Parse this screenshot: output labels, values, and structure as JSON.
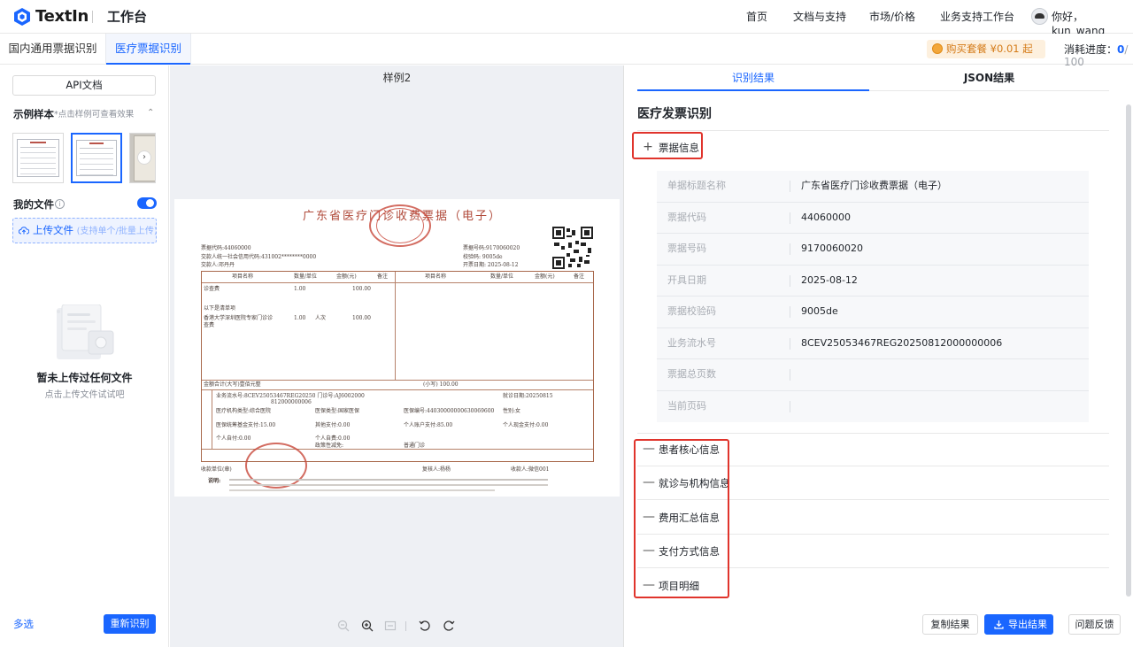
{
  "header": {
    "brand": "TextIn",
    "workspace": "工作台",
    "nav": [
      "首页",
      "文档与支持",
      "市场/价格",
      "业务支持工作台"
    ],
    "greeting": "你好，kun_wang"
  },
  "tabs": {
    "items": [
      "国内通用票据识别",
      "医疗票据识别"
    ],
    "active_index": 1,
    "buy_label": "购买套餐 ¥0.01 起",
    "usage_label": "消耗进度：",
    "usage_current": "0",
    "usage_total": "/ 100"
  },
  "left": {
    "api_doc_label": "API文档",
    "samples_title": "示例样本",
    "samples_hint": "*点击样例可查看效果",
    "my_files": "我的文件",
    "upload_label": "上传文件",
    "upload_sub": "(支持单个/批量上传)",
    "empty_title": "暂未上传过任何文件",
    "empty_sub": "点击上传文件试试吧",
    "multiselect": "多选",
    "rerun": "重新识别"
  },
  "viewer": {
    "title": "样例2"
  },
  "invoice": {
    "title": "广东省医疗门诊收费票据（电子）",
    "lines": [
      "票据代码:44060000",
      "交款人统一社会信用代码:431002********0000",
      "交款人:邓丹丹",
      "票据号码:9170060020",
      "校验码:  9005de",
      "开票日期: 2025-08-12",
      "项目名称",
      "数量/单位",
      "金额(元)",
      "备注",
      "项目名称",
      "数量/单位",
      "金额(元)",
      "备注",
      "诊查费",
      "1.00",
      "100.00",
      "以下是清单项",
      "香港大学深圳医院专家门诊诊",
      "查费",
      "1.00",
      "人次",
      "100.00",
      "金额合计(大写)壹佰元整",
      "(小写) 100.00",
      "业务流水号:8CEV25053467REG20250 门诊号:AJ6002000",
      "812000000006",
      "就诊日期:20250815",
      "医疗机构类型:综合医院",
      "医保类型:国家医保",
      "医保编号:44030000000630069600",
      "性别:女",
      "医保统筹基金支付:15.00",
      "其他支付:0.00",
      "个人账户支付:85.00",
      "个人现金支付:0.00",
      "个人自付:0.00",
      "个人自费:0.00",
      "普通门诊",
      "政策性减免:",
      "收款单位(章)",
      "复核人:杨杨",
      "收款人:微信001",
      "说明:"
    ]
  },
  "right": {
    "tabs": [
      "识别结果",
      "JSON结果"
    ],
    "heading": "医疗发票识别",
    "expanded_section": "票据信息",
    "fields": [
      {
        "label": "单据标题名称",
        "value": "广东省医疗门诊收费票据（电子）"
      },
      {
        "label": "票据代码",
        "value": "44060000"
      },
      {
        "label": "票据号码",
        "value": "9170060020"
      },
      {
        "label": "开具日期",
        "value": "2025-08-12"
      },
      {
        "label": "票据校验码",
        "value": "9005de"
      },
      {
        "label": "业务流水号",
        "value": "8CEV25053467REG20250812000000006"
      },
      {
        "label": "票据总页数",
        "value": ""
      },
      {
        "label": "当前页码",
        "value": ""
      }
    ],
    "sections": [
      "患者核心信息",
      "就诊与机构信息",
      "费用汇总信息",
      "支付方式信息",
      "项目明细"
    ],
    "buttons": {
      "copy": "复制结果",
      "export": "导出结果",
      "feedback": "问题反馈"
    }
  },
  "colors": {
    "accent": "#1a66ff",
    "highlight": "#e0342c",
    "stamp": "#c8473a"
  }
}
